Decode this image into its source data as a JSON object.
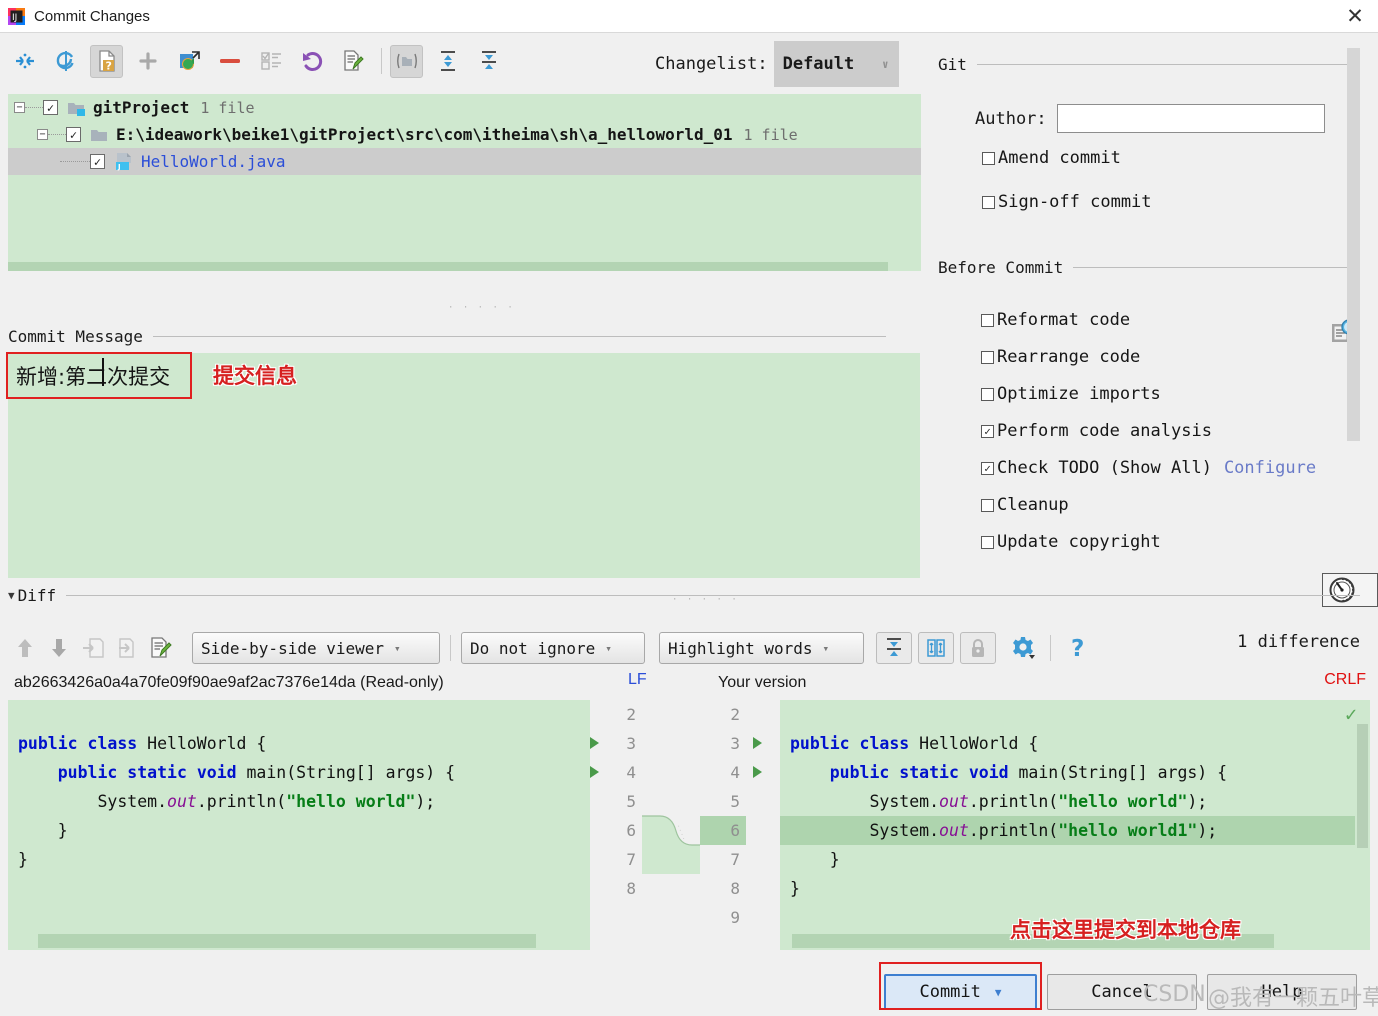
{
  "window": {
    "title": "Commit Changes",
    "app_icon": "intellij-idea-icon",
    "close_label": "✕"
  },
  "toolbar": {
    "buttons": [
      {
        "name": "show-diff-icon",
        "glyph": "diff"
      },
      {
        "name": "refresh-icon",
        "glyph": "refresh"
      },
      {
        "name": "unversioned-files-icon",
        "glyph": "question-doc",
        "selected": true
      },
      {
        "name": "add-icon",
        "glyph": "plus"
      },
      {
        "name": "move-to-changelist-icon",
        "glyph": "move"
      },
      {
        "name": "delete-icon",
        "glyph": "minus"
      },
      {
        "name": "select-all-icon",
        "glyph": "checklist"
      },
      {
        "name": "revert-icon",
        "glyph": "undo"
      },
      {
        "name": "edit-source-icon",
        "glyph": "edit-doc"
      },
      {
        "name": "group-by-directory-icon",
        "glyph": "folder-bracket",
        "selected": true
      },
      {
        "name": "expand-all-icon",
        "glyph": "expand"
      },
      {
        "name": "collapse-all-icon",
        "glyph": "collapse"
      }
    ]
  },
  "changelist": {
    "label": "Changelist:",
    "selected": "Default",
    "arrow": "∨"
  },
  "file_tree": {
    "rows": [
      {
        "name": "gitProject",
        "count": "1 file",
        "checked": true,
        "expanded": true,
        "kind": "project",
        "selected": false
      },
      {
        "name": "E:\\ideawork\\beike1\\gitProject\\src\\com\\itheima\\sh\\a_helloworld_01",
        "count": "1 file",
        "checked": true,
        "expanded": true,
        "kind": "folder",
        "selected": false
      },
      {
        "name": "HelloWorld.java",
        "count": "",
        "checked": true,
        "expanded": null,
        "kind": "java-file",
        "selected": true
      }
    ]
  },
  "commit_message": {
    "section_title": "Commit Message",
    "value": "新增:第二次提交",
    "history_icon": "message-history-icon",
    "annotation": "提交信息"
  },
  "git_panel": {
    "section_title": "Git",
    "author_label": "Author:",
    "author_value": "",
    "author_placeholder": "",
    "options": [
      {
        "label": "Amend commit",
        "checked": false,
        "name": "amend-commit-checkbox"
      },
      {
        "label": "Sign-off commit",
        "checked": false,
        "name": "sign-off-commit-checkbox"
      }
    ]
  },
  "before_commit": {
    "section_title": "Before Commit",
    "options": [
      {
        "label": "Reformat code",
        "checked": false,
        "name": "reformat-code-checkbox"
      },
      {
        "label": "Rearrange code",
        "checked": false,
        "name": "rearrange-code-checkbox"
      },
      {
        "label": "Optimize imports",
        "checked": false,
        "name": "optimize-imports-checkbox"
      },
      {
        "label": "Perform code analysis",
        "checked": true,
        "name": "perform-code-analysis-checkbox"
      },
      {
        "label": "Check TODO (Show All)",
        "checked": true,
        "name": "check-todo-checkbox",
        "link": "Configure"
      },
      {
        "label": "Cleanup",
        "checked": false,
        "name": "cleanup-checkbox"
      },
      {
        "label": "Update copyright",
        "checked": false,
        "name": "update-copyright-checkbox"
      }
    ]
  },
  "diff": {
    "section_title": "Diff",
    "collapse_caret": "▼",
    "toolbar": {
      "icons": [
        {
          "name": "previous-difference-icon",
          "glyph": "arrow-up"
        },
        {
          "name": "next-difference-icon",
          "glyph": "arrow-down"
        },
        {
          "name": "accept-left-icon",
          "glyph": "doc-left"
        },
        {
          "name": "accept-right-icon",
          "glyph": "doc-right"
        },
        {
          "name": "edit-source-icon",
          "glyph": "edit-doc"
        }
      ],
      "viewer_mode": "Side-by-side viewer",
      "whitespace_mode": "Do not ignore",
      "highlight_mode": "Highlight words",
      "buttons": [
        {
          "name": "collapse-unchanged-icon",
          "glyph": "collapse"
        },
        {
          "name": "synchronize-scrolling-icon",
          "glyph": "sync-scroll"
        },
        {
          "name": "read-only-lock-icon",
          "glyph": "lock"
        }
      ],
      "settings_icon": "gear-icon",
      "help_icon": "question-mark-icon",
      "difference_count": "1 difference"
    },
    "left_title": "ab2663426a0a4a70fe09f90ae9af2ac7376e14da (Read-only)",
    "right_title": "Your version",
    "left_line_ending": "LF",
    "right_line_ending": "CRLF",
    "left_lines": [
      {
        "num": "2",
        "code": "",
        "marker": null
      },
      {
        "num": "3",
        "code": "public class HelloWorld {",
        "marker": "arrow"
      },
      {
        "num": "4",
        "code": "    public static void main(String[] args) {",
        "marker": "arrow"
      },
      {
        "num": "5",
        "code": "        System.out.println(\"hello world\");",
        "marker": null
      },
      {
        "num": "6",
        "code": "    }",
        "marker": null
      },
      {
        "num": "7",
        "code": "}",
        "marker": null
      },
      {
        "num": "8",
        "code": "",
        "marker": null
      }
    ],
    "right_lines": [
      {
        "num": "2",
        "code": "",
        "marker": null,
        "highlight": false
      },
      {
        "num": "3",
        "code": "public class HelloWorld {",
        "marker": "arrow",
        "highlight": false
      },
      {
        "num": "4",
        "code": "    public static void main(String[] args) {",
        "marker": "arrow",
        "highlight": false
      },
      {
        "num": "5",
        "code": "        System.out.println(\"hello world\");",
        "marker": null,
        "highlight": false
      },
      {
        "num": "6",
        "code": "        System.out.println(\"hello world1\");",
        "marker": null,
        "highlight": true
      },
      {
        "num": "7",
        "code": "    }",
        "marker": null,
        "highlight": false
      },
      {
        "num": "8",
        "code": "}",
        "marker": null,
        "highlight": false
      },
      {
        "num": "9",
        "code": "",
        "marker": null,
        "highlight": false
      }
    ]
  },
  "annotations": {
    "commit_hint": "点击这里提交到本地仓库"
  },
  "buttons": {
    "commit": "Commit",
    "commit_arrow": "▼",
    "cancel": "Cancel",
    "help": "Help"
  },
  "watermark": {
    "site": "CSDN",
    "user": "@我有一颗五叶草"
  },
  "colors": {
    "changed_bg": "#cfe8cf",
    "highlight": "#aed4ae",
    "link": "#6a7bc8",
    "annotation_red": "#d62020",
    "keyword": "#0011cc",
    "string": "#067d17"
  }
}
